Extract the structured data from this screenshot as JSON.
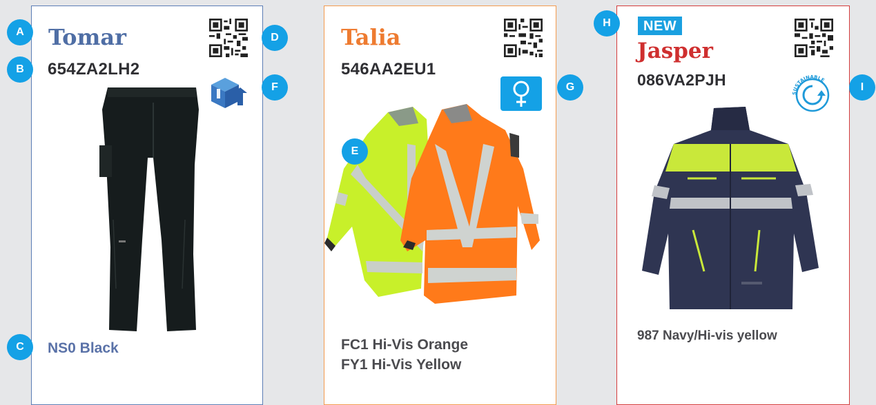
{
  "products": [
    {
      "name": "Tomar",
      "code": "654ZA2LH2",
      "colors": [
        "NS0 Black"
      ]
    },
    {
      "name": "Talia",
      "code": "546AA2EU1",
      "colors": [
        "FC1 Hi-Vis Orange",
        "FY1 Hi-Vis Yellow"
      ]
    },
    {
      "name": "Jasper",
      "code": "086VA2PJH",
      "colors": [
        "987 Navy/Hi-vis yellow"
      ],
      "badge": "NEW",
      "sustainable_label": "SUSTAINABLE"
    }
  ],
  "markers": [
    "A",
    "B",
    "C",
    "D",
    "E",
    "F",
    "G",
    "H",
    "I"
  ],
  "icons": {
    "qr": "qr-code-icon",
    "delivery": "box-delivery-icon",
    "female": "female-symbol-icon",
    "sustainable": "sustainable-recycle-icon"
  },
  "colors": {
    "tomar_accent": "#4f6ea5",
    "talia_accent": "#ee7b30",
    "jasper_accent": "#cf2f2f",
    "marker_blue": "#14a1e6",
    "hivis_yellow": "#c8f02a",
    "hivis_orange": "#ff7a1a",
    "navy": "#2f3552"
  }
}
